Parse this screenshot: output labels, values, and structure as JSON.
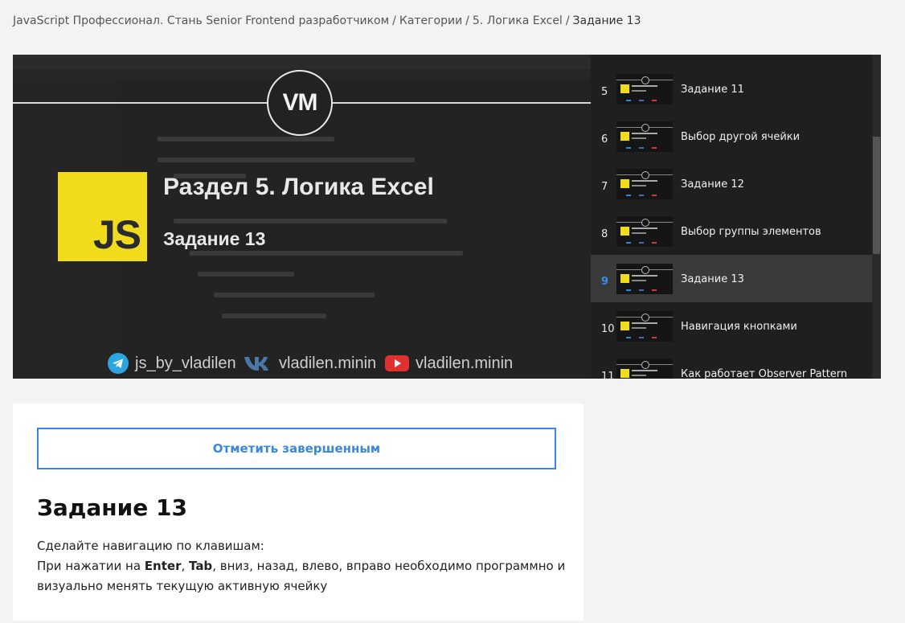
{
  "breadcrumb": {
    "items": [
      "JavaScript Профессионал. Стань Senior Frontend разработчиком",
      "Категории",
      "5. Логика Excel"
    ],
    "current": "Задание 13",
    "separator": "/"
  },
  "video": {
    "logo_text": "VM",
    "js_badge": "JS",
    "title": "Раздел 5. Логика Excel",
    "subtitle": "Задание 13",
    "social": {
      "telegram": "js_by_vladilen",
      "vk": "vladilen.minin",
      "youtube": "vladilen.minin"
    }
  },
  "playlist": {
    "items": [
      {
        "num": "5",
        "title": "Задание 11",
        "active": false
      },
      {
        "num": "6",
        "title": "Выбор другой ячейки",
        "active": false
      },
      {
        "num": "7",
        "title": "Задание 12",
        "active": false
      },
      {
        "num": "8",
        "title": "Выбор группы элементов",
        "active": false
      },
      {
        "num": "9",
        "title": "Задание 13",
        "active": true
      },
      {
        "num": "10",
        "title": "Навигация кнопками",
        "active": false
      },
      {
        "num": "11",
        "title": "Как работает Observer Pattern",
        "active": false
      }
    ]
  },
  "lesson": {
    "complete_button": "Отметить завершенным",
    "title": "Задание 13",
    "desc_line1": "Сделайте навигацию по клавишам:",
    "desc_line2_pre": "При нажатии на ",
    "key_enter": "Enter",
    "comma": ", ",
    "key_tab": "Tab",
    "desc_line2_post": ", вниз, назад, влево, вправо необходимо программно и визуально менять текущую активную ячейку"
  },
  "colors": {
    "accent": "#3b87dd",
    "js_yellow": "#f0db1c",
    "active_num": "#3b8de3"
  }
}
